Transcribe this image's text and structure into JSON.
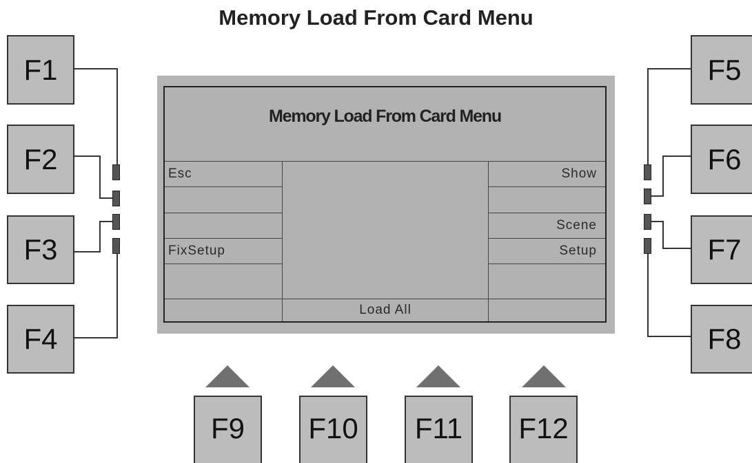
{
  "title": "Memory Load From Card Menu",
  "screen": {
    "title": "Memory Load From Card Menu",
    "left_items": [
      "Esc",
      "",
      "",
      "FixSetup",
      "",
      ""
    ],
    "right_items": [
      "Show",
      "",
      "Scene",
      "Setup",
      "",
      ""
    ],
    "bottom_center": "Load All"
  },
  "side_keys_left": [
    "F1",
    "F2",
    "F3",
    "F4"
  ],
  "side_keys_right": [
    "F5",
    "F6",
    "F7",
    "F8"
  ],
  "bottom_keys": [
    "F9",
    "F10",
    "F11",
    "F12"
  ],
  "colors": {
    "key_fill": "#bcbcbc",
    "screen_fill": "#b2b2b2",
    "bezel": "#b4b4b4",
    "arrow": "#707070",
    "connector": "#555555"
  }
}
